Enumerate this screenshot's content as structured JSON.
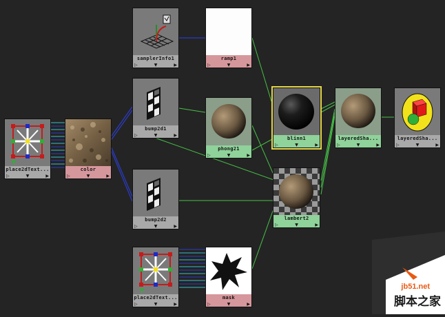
{
  "nodes": {
    "samplerinfo": {
      "label": "samplerInfo1"
    },
    "ramp": {
      "label": "ramp1"
    },
    "bump1": {
      "label": "bump2d1"
    },
    "phong": {
      "label": "phong21"
    },
    "blinn": {
      "label": "blinn1"
    },
    "layeredshader": {
      "label": "layeredSha..."
    },
    "layeredshader_sg": {
      "label": "layeredSha..."
    },
    "place2d_a": {
      "label": "place2dText..."
    },
    "color": {
      "label": "color"
    },
    "bump2": {
      "label": "bump2d2"
    },
    "lambert": {
      "label": "lambert2"
    },
    "place2d_b": {
      "label": "place2dText..."
    },
    "mask": {
      "label": "mask"
    }
  },
  "watermark": {
    "url": "jb51.net",
    "site_name": "脚本之家"
  },
  "colors": {
    "connection_green": "#47c247",
    "connection_blue": "#2b3cc8",
    "connection_cyan": "#35c0d0",
    "selected_outline": "#e8d84a"
  }
}
